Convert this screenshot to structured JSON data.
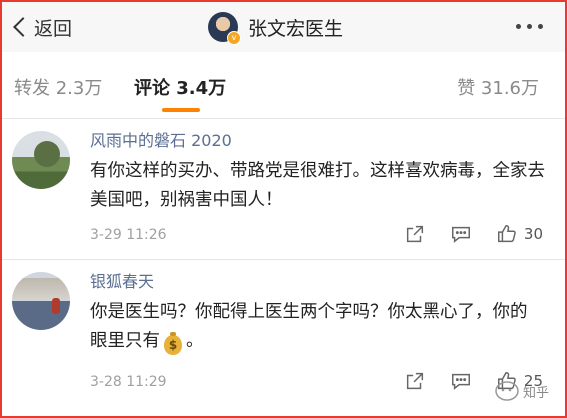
{
  "header": {
    "back_label": "返回",
    "title": "张文宏医生",
    "verified_badge": "v",
    "back_icon": "chevron-left-icon",
    "more_icon": "more-horizontal-icon"
  },
  "tabs": {
    "repost": {
      "label": "转发",
      "count": "2.3万"
    },
    "comments": {
      "label": "评论",
      "count": "3.4万",
      "active": true
    },
    "likes": {
      "label": "赞",
      "count": "31.6万"
    },
    "accent_color": "#ff8200"
  },
  "comments": [
    {
      "author": "风雨中的磐石 2020",
      "text": "有你这样的买办、带路党是很难打。这样喜欢病毒，全家去美国吧，别祸害中国人！",
      "time": "3-29 11:26",
      "likes": "30"
    },
    {
      "author": "银狐春天",
      "text_before": "你是医生吗？你配得上医生两个字吗？你太黑心了，你的眼里只有",
      "emoji": "money-bag-icon",
      "emoji_glyph": "$",
      "text_after": "。",
      "time": "3-28 11:29",
      "likes": "25"
    }
  ],
  "watermark": {
    "text": "知乎"
  },
  "colors": {
    "frame": "#e83b30",
    "username": "#5b6f93",
    "muted": "#a0a0a0"
  }
}
